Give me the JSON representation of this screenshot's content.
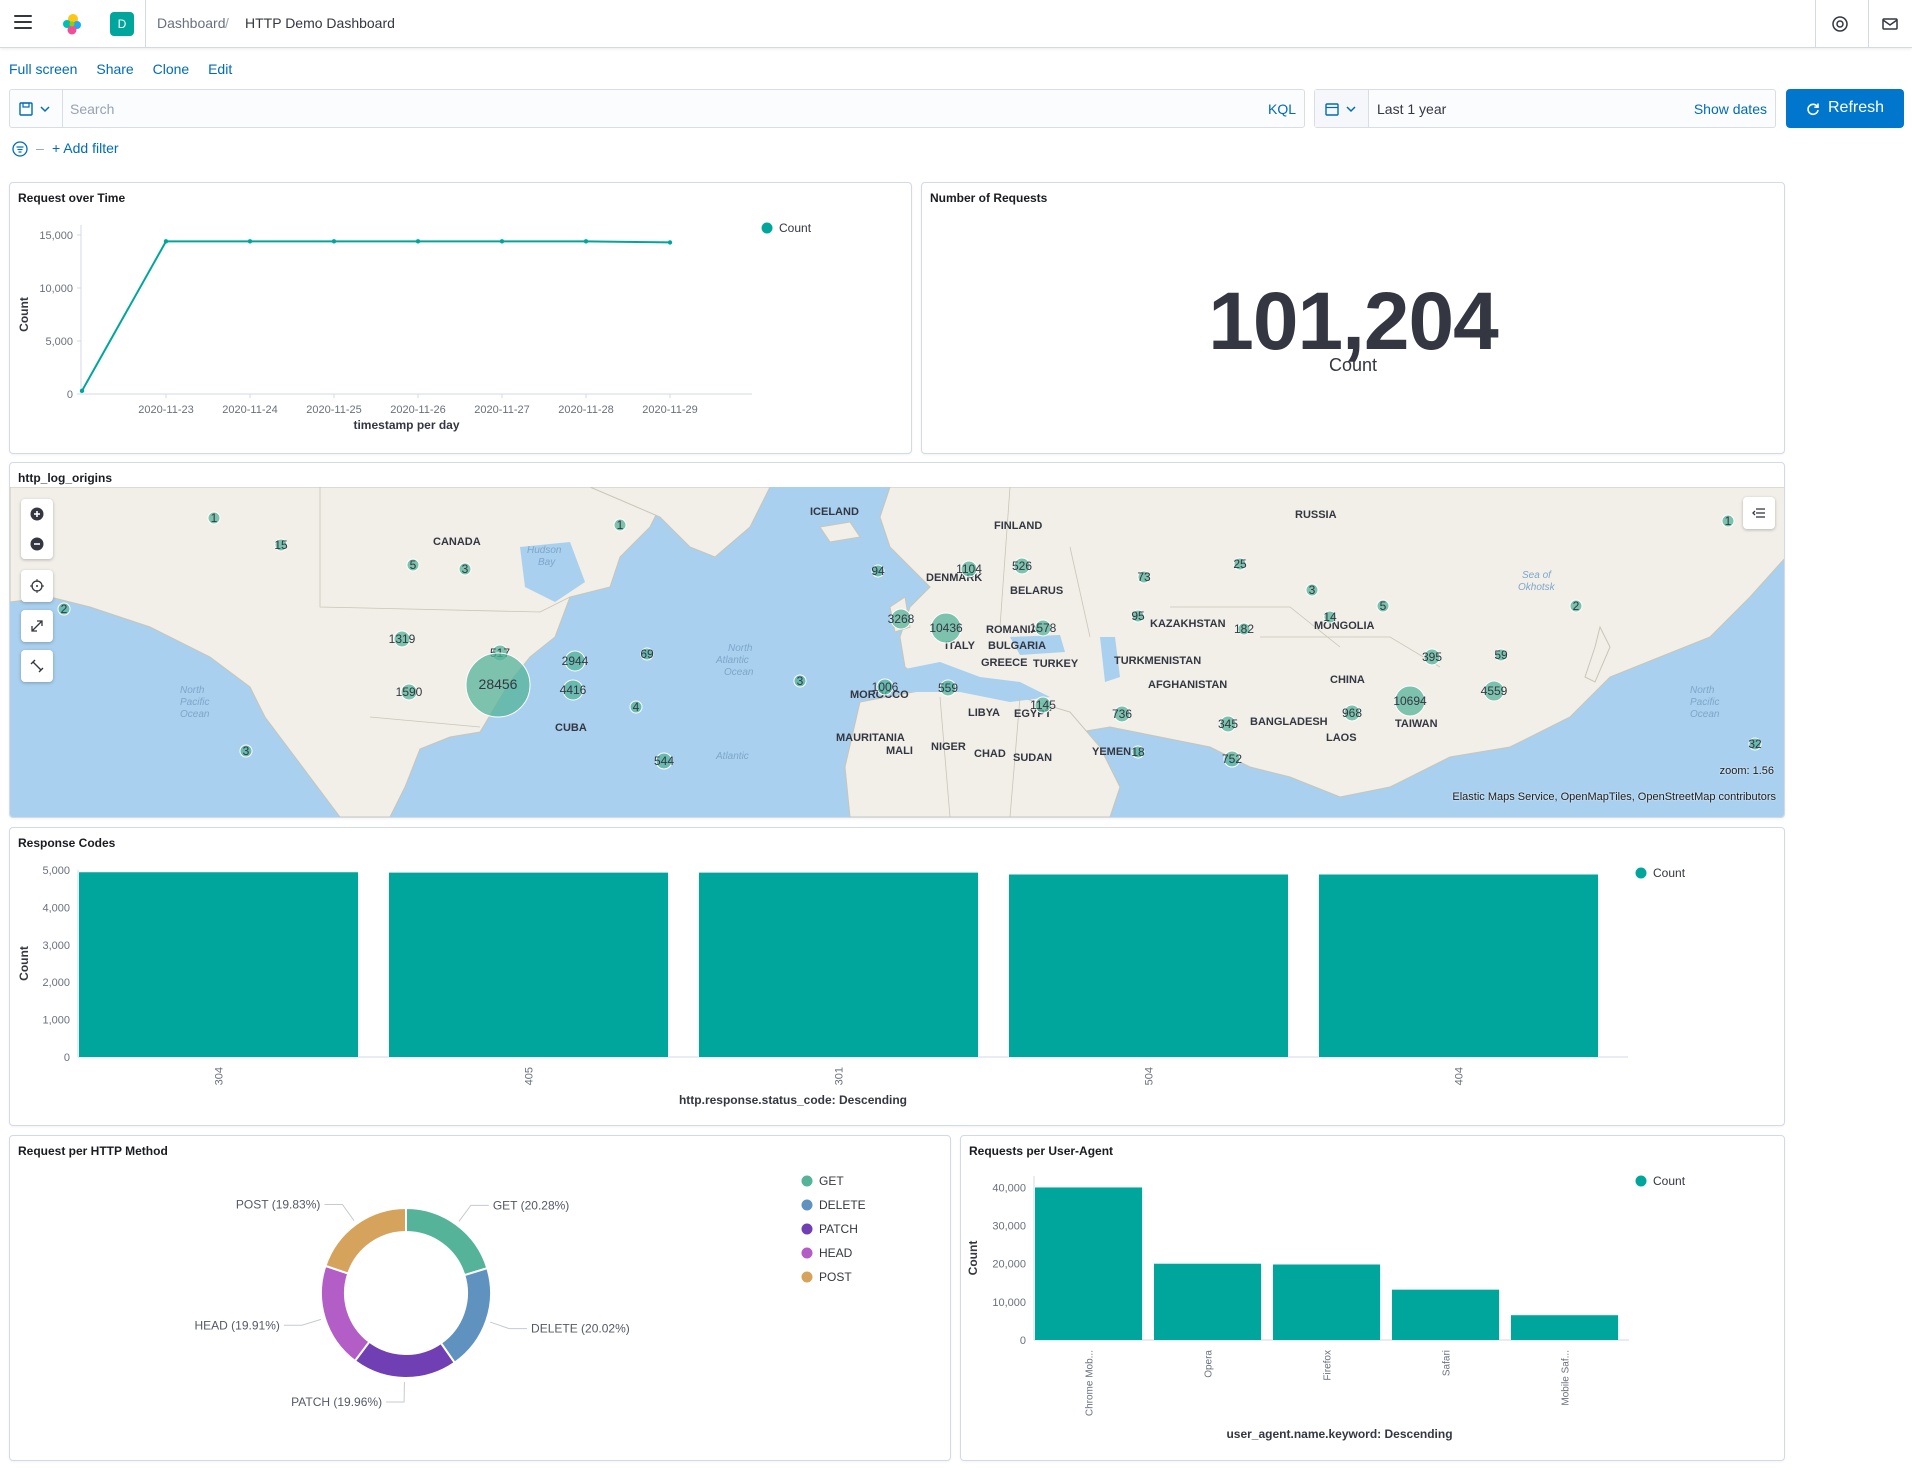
{
  "header": {
    "space_initial": "D",
    "breadcrumb_root": "Dashboard",
    "breadcrumb_current": "HTTP Demo Dashboard"
  },
  "actions": [
    "Full screen",
    "Share",
    "Clone",
    "Edit"
  ],
  "query": {
    "placeholder": "Search",
    "language": "KQL"
  },
  "time": {
    "range": "Last 1 year",
    "show_dates": "Show dates",
    "refresh": "Refresh"
  },
  "filter": {
    "add_label": "+ Add filter"
  },
  "panels": {
    "requests_over_time": {
      "title": "Request over Time",
      "chart_data": {
        "type": "line",
        "x": [
          "2020-11-22",
          "2020-11-23",
          "2020-11-24",
          "2020-11-25",
          "2020-11-26",
          "2020-11-27",
          "2020-11-28",
          "2020-11-29"
        ],
        "xticks": [
          "2020-11-23",
          "2020-11-24",
          "2020-11-25",
          "2020-11-26",
          "2020-11-27",
          "2020-11-28",
          "2020-11-29"
        ],
        "series": [
          {
            "name": "Count",
            "values": [
              300,
              14400,
              14400,
              14400,
              14400,
              14400,
              14400,
              14300
            ]
          }
        ],
        "ylim": [
          0,
          15000
        ],
        "yticks": [
          "0",
          "5,000",
          "10,000",
          "15,000"
        ],
        "xlabel": "timestamp per day",
        "ylabel": "Count",
        "color": "#00a69b",
        "legend_position": "top-right"
      }
    },
    "number_of_requests": {
      "title": "Number of Requests",
      "value": "101,204",
      "label": "Count"
    },
    "map": {
      "title": "http_log_origins",
      "zoom": "zoom: 1.56",
      "attribution": "Elastic Maps Service, OpenMapTiles, OpenStreetMap contributors",
      "labels": [
        "CANADA",
        "Hudson Bay",
        "ICELAND",
        "FINLAND",
        "RUSSIA",
        "DENMARK",
        "BELARUS",
        "KAZAKHSTAN",
        "MONGOLIA",
        "ROMANIA",
        "ITALY",
        "BULGARIA",
        "GREECE",
        "TURKEY",
        "TURKMENISTAN",
        "AFGHANISTAN",
        "CHINA",
        "MOROCCO",
        "LIBYA",
        "EGYPT",
        "BANGLADESH",
        "TAIWAN",
        "MAURITANIA",
        "MALI",
        "NIGER",
        "CHAD",
        "SUDAN",
        "YEMEN",
        "LAOS",
        "CUBA",
        "North Atlantic Ocean",
        "North Pacific Ocean",
        "Sea of Okhotsk",
        "Atlantic"
      ],
      "clusters": [
        "1",
        "15",
        "5",
        "3",
        "1",
        "2",
        "1319",
        "517",
        "2944",
        "69",
        "28456",
        "4416",
        "1590",
        "4",
        "3",
        "544",
        "3",
        "94",
        "1104",
        "526",
        "73",
        "25",
        "3",
        "5",
        "1",
        "3268",
        "10436",
        "95",
        "1578",
        "182",
        "14",
        "2",
        "395",
        "59",
        "1006",
        "559",
        "1145",
        "736",
        "345",
        "18",
        "752",
        "4559",
        "10694",
        "968",
        "32"
      ]
    },
    "response_codes": {
      "title": "Response Codes",
      "chart_data": {
        "type": "bar",
        "categories": [
          "304",
          "405",
          "301",
          "504",
          "404"
        ],
        "series": [
          {
            "name": "Count",
            "values": [
              4940,
              4930,
              4930,
              4880,
              4880
            ]
          }
        ],
        "ylim": [
          0,
          5000
        ],
        "yticks": [
          "0",
          "1,000",
          "2,000",
          "3,000",
          "4,000",
          "5,000"
        ],
        "xlabel": "http.response.status_code: Descending",
        "ylabel": "Count",
        "color": "#00a69b"
      }
    },
    "http_method": {
      "title": "Request per HTTP Method",
      "chart_data": {
        "type": "pie",
        "labels": [
          "GET",
          "DELETE",
          "PATCH",
          "HEAD",
          "POST"
        ],
        "values": [
          20.28,
          20.02,
          19.96,
          19.91,
          19.83
        ],
        "slice_labels": [
          "GET (20.28%)",
          "DELETE (20.02%)",
          "PATCH (19.96%)",
          "HEAD (19.91%)",
          "POST (19.83%)"
        ],
        "colors": [
          "#54b399",
          "#6092c0",
          "#6f3fb3",
          "#b35ec7",
          "#d6a35c"
        ],
        "donut": true
      }
    },
    "user_agent": {
      "title": "Requests per User-Agent",
      "chart_data": {
        "type": "bar",
        "categories": [
          "Chrome Mob...",
          "Opera",
          "Firefox",
          "Safari",
          "Mobile Saf..."
        ],
        "series": [
          {
            "name": "Count",
            "values": [
              40000,
              20000,
              19800,
              13200,
              6500
            ]
          }
        ],
        "ylim": [
          0,
          43000
        ],
        "yticks": [
          "0",
          "10,000",
          "20,000",
          "30,000",
          "40,000"
        ],
        "xlabel": "user_agent.name.keyword: Descending",
        "ylabel": "Count",
        "color": "#00a69b"
      }
    }
  }
}
